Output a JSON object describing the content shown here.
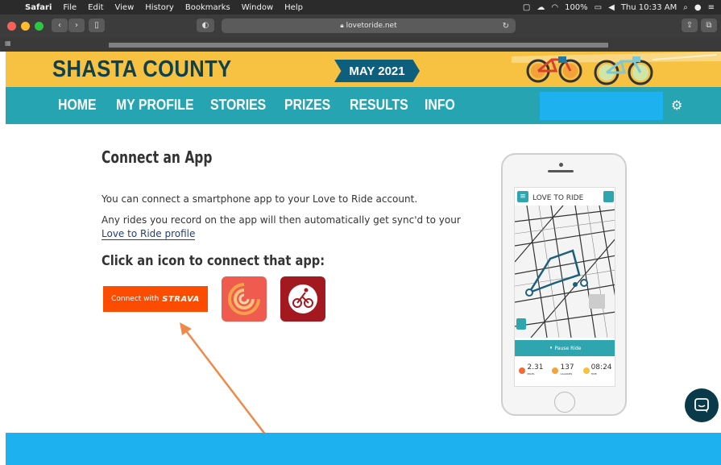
{
  "menubar": {
    "app": "Safari",
    "items": [
      "File",
      "Edit",
      "View",
      "History",
      "Bookmarks",
      "Window",
      "Help"
    ],
    "battery": "100%",
    "clock": "Thu 10:33 AM"
  },
  "browser": {
    "url": "lovetoride.net"
  },
  "site": {
    "brand": "SHASTA COUNTY",
    "month": "MAY 2021",
    "nav": [
      {
        "label": "HOME"
      },
      {
        "label": "MY PROFILE"
      },
      {
        "label": "STORIES"
      },
      {
        "label": "PRIZES"
      },
      {
        "label": "RESULTS"
      },
      {
        "label": "INFO"
      }
    ]
  },
  "main": {
    "heading": "Connect an App",
    "para1": "You can connect a smartphone app to your Love to Ride account.",
    "para2_pre": "Any rides you record on the app will then automatically get sync'd to your ",
    "para2_link": "Love to Ride profile",
    "subheading": "Click an icon to connect that app:",
    "strava_prefix": "Connect with",
    "strava_logo": "STRAVA"
  },
  "phone": {
    "title": "LOVE TO RIDE",
    "pause_label": "Pause Ride",
    "stats": [
      {
        "value": "2.31",
        "label": "MILES"
      },
      {
        "value": "137",
        "label": "CALORIES"
      },
      {
        "value": "08:24",
        "label": "TIME"
      }
    ]
  },
  "colors": {
    "header_yellow": "#f7c241",
    "nav_teal": "#26a4b2",
    "strava_orange": "#fc4c02",
    "highlight_blue": "#1db1f0",
    "arrow": "#f08a4b"
  }
}
